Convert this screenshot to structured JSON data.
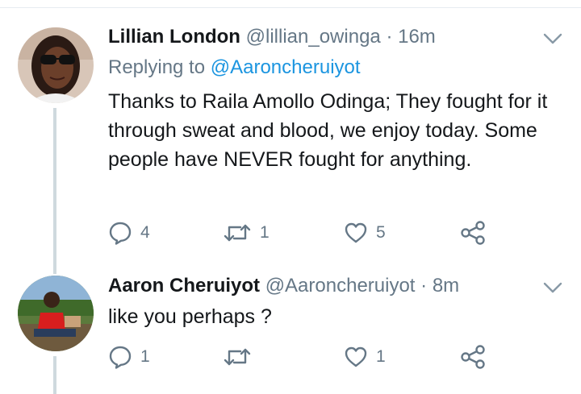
{
  "tweets": [
    {
      "name": "Lillian London",
      "handle": "@lillian_owinga",
      "separator": "·",
      "time": "16m",
      "replying_to_prefix": "Replying to",
      "replying_to_handle": "@Aaroncheruiyot",
      "text": "Thanks to Raila Amollo Odinga; They fought for it through sweat and blood, we enjoy today. Some people have NEVER fought for anything.",
      "replies": "4",
      "retweets": "1",
      "likes": "5"
    },
    {
      "name": "Aaron Cheruiyot",
      "handle": "@Aaroncheruiyot",
      "separator": "·",
      "time": "8m",
      "text": "like you perhaps ?",
      "replies": "1",
      "retweets": "",
      "likes": "1"
    }
  ],
  "colors": {
    "name": "#14171a",
    "secondary": "#657786",
    "link": "#1b95e0",
    "thread_line": "#cfd9de",
    "icon": "#657786"
  }
}
